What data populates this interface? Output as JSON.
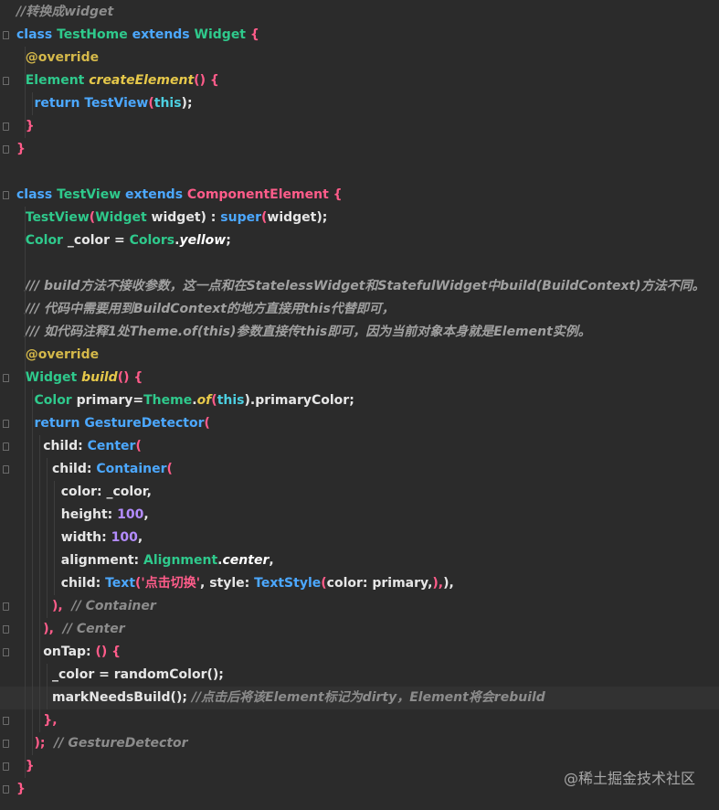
{
  "lines": [
    {
      "segments": [
        {
          "t": "//转换成widget",
          "c": "c-cmt"
        }
      ]
    },
    {
      "segments": [
        {
          "t": "class ",
          "c": "c-kw"
        },
        {
          "t": "TestHome ",
          "c": "c-type"
        },
        {
          "t": "extends ",
          "c": "c-kw"
        },
        {
          "t": "Widget ",
          "c": "c-type"
        },
        {
          "t": "{",
          "c": "c-pink"
        }
      ]
    },
    {
      "segments": [
        {
          "t": "  @override",
          "c": "c-anno"
        }
      ]
    },
    {
      "segments": [
        {
          "t": "  Element ",
          "c": "c-type"
        },
        {
          "t": "createElement",
          "c": "c-yellow"
        },
        {
          "t": "() {",
          "c": "c-pink"
        }
      ]
    },
    {
      "segments": [
        {
          "t": "    return ",
          "c": "c-kw"
        },
        {
          "t": "TestView",
          "c": "c-kw"
        },
        {
          "t": "(",
          "c": "c-pink"
        },
        {
          "t": "this",
          "c": "c-this"
        },
        {
          "t": ");",
          "c": "c-white"
        }
      ]
    },
    {
      "segments": [
        {
          "t": "  }",
          "c": "c-pink"
        }
      ]
    },
    {
      "segments": [
        {
          "t": "}",
          "c": "c-pink"
        }
      ]
    },
    {
      "segments": [
        {
          "t": "",
          "c": "c-white"
        }
      ]
    },
    {
      "segments": [
        {
          "t": "class ",
          "c": "c-kw"
        },
        {
          "t": "TestView ",
          "c": "c-type"
        },
        {
          "t": "extends ",
          "c": "c-kw"
        },
        {
          "t": "ComponentElement ",
          "c": "c-pink"
        },
        {
          "t": "{",
          "c": "c-pink"
        }
      ]
    },
    {
      "segments": [
        {
          "t": "  TestView",
          "c": "c-type"
        },
        {
          "t": "(",
          "c": "c-pink"
        },
        {
          "t": "Widget ",
          "c": "c-type"
        },
        {
          "t": "widget",
          "c": "c-white"
        },
        {
          "t": ") : ",
          "c": "c-white"
        },
        {
          "t": "super",
          "c": "c-kw"
        },
        {
          "t": "(",
          "c": "c-pink"
        },
        {
          "t": "widget",
          "c": "c-white"
        },
        {
          "t": ");",
          "c": "c-white"
        }
      ]
    },
    {
      "segments": [
        {
          "t": "  Color ",
          "c": "c-type"
        },
        {
          "t": "_color = ",
          "c": "c-white"
        },
        {
          "t": "Colors",
          "c": "c-type"
        },
        {
          "t": ".",
          "c": "c-white"
        },
        {
          "t": "yellow",
          "c": "c-italic"
        },
        {
          "t": ";",
          "c": "c-white"
        }
      ]
    },
    {
      "segments": [
        {
          "t": "",
          "c": "c-white"
        }
      ]
    },
    {
      "segments": [
        {
          "t": "  /// build方法不接收参数，这一点和在StatelessWidget和StatefulWidget中build(BuildContext)方法不同。",
          "c": "c-doc"
        }
      ]
    },
    {
      "segments": [
        {
          "t": "  /// 代码中需要用到BuildContext的地方直接用this代替即可，",
          "c": "c-doc"
        }
      ]
    },
    {
      "segments": [
        {
          "t": "  /// 如代码注释1处Theme.of(this)参数直接传this即可，因为当前对象本身就是Element实例。",
          "c": "c-doc"
        }
      ]
    },
    {
      "segments": [
        {
          "t": "  @override",
          "c": "c-anno"
        }
      ]
    },
    {
      "segments": [
        {
          "t": "  Widget ",
          "c": "c-type"
        },
        {
          "t": "build",
          "c": "c-yellow"
        },
        {
          "t": "() {",
          "c": "c-pink"
        }
      ]
    },
    {
      "segments": [
        {
          "t": "    Color ",
          "c": "c-type"
        },
        {
          "t": "primary=",
          "c": "c-white"
        },
        {
          "t": "Theme",
          "c": "c-type"
        },
        {
          "t": ".",
          "c": "c-white"
        },
        {
          "t": "of",
          "c": "c-yellow"
        },
        {
          "t": "(",
          "c": "c-pink"
        },
        {
          "t": "this",
          "c": "c-this"
        },
        {
          "t": ").primaryColor;",
          "c": "c-white"
        }
      ]
    },
    {
      "segments": [
        {
          "t": "    return ",
          "c": "c-kw"
        },
        {
          "t": "GestureDetector",
          "c": "c-kw"
        },
        {
          "t": "(",
          "c": "c-pink"
        }
      ]
    },
    {
      "segments": [
        {
          "t": "      child: ",
          "c": "c-white"
        },
        {
          "t": "Center",
          "c": "c-kw"
        },
        {
          "t": "(",
          "c": "c-pink"
        }
      ]
    },
    {
      "segments": [
        {
          "t": "        child: ",
          "c": "c-white"
        },
        {
          "t": "Container",
          "c": "c-kw"
        },
        {
          "t": "(",
          "c": "c-pink"
        }
      ]
    },
    {
      "segments": [
        {
          "t": "          color: _color,",
          "c": "c-white"
        }
      ]
    },
    {
      "segments": [
        {
          "t": "          height: ",
          "c": "c-white"
        },
        {
          "t": "100",
          "c": "c-num"
        },
        {
          "t": ",",
          "c": "c-white"
        }
      ]
    },
    {
      "segments": [
        {
          "t": "          width: ",
          "c": "c-white"
        },
        {
          "t": "100",
          "c": "c-num"
        },
        {
          "t": ",",
          "c": "c-white"
        }
      ]
    },
    {
      "segments": [
        {
          "t": "          alignment: ",
          "c": "c-white"
        },
        {
          "t": "Alignment",
          "c": "c-type"
        },
        {
          "t": ".",
          "c": "c-white"
        },
        {
          "t": "center",
          "c": "c-italic"
        },
        {
          "t": ",",
          "c": "c-white"
        }
      ]
    },
    {
      "segments": [
        {
          "t": "          child: ",
          "c": "c-white"
        },
        {
          "t": "Text",
          "c": "c-kw"
        },
        {
          "t": "('点击切换'",
          "c": "c-str"
        },
        {
          "t": ", style: ",
          "c": "c-white"
        },
        {
          "t": "TextStyle",
          "c": "c-kw"
        },
        {
          "t": "(",
          "c": "c-pink"
        },
        {
          "t": "color: primary,",
          "c": "c-white"
        },
        {
          "t": "),",
          "c": "c-pink"
        },
        {
          "t": "),",
          "c": "c-white"
        }
      ]
    },
    {
      "segments": [
        {
          "t": "        ),  ",
          "c": "c-pink"
        },
        {
          "t": "// Container",
          "c": "c-cmt"
        }
      ]
    },
    {
      "segments": [
        {
          "t": "      ),  ",
          "c": "c-pink"
        },
        {
          "t": "// Center",
          "c": "c-cmt"
        }
      ]
    },
    {
      "segments": [
        {
          "t": "      onTap: ",
          "c": "c-white"
        },
        {
          "t": "() {",
          "c": "c-pink"
        }
      ]
    },
    {
      "segments": [
        {
          "t": "        _color = randomColor();",
          "c": "c-white"
        }
      ]
    },
    {
      "segments": [
        {
          "t": "        markNeedsBuild(); ",
          "c": "c-white"
        },
        {
          "t": "//点击后将该Element标记为dirty，Element将会rebuild",
          "c": "c-cmt"
        }
      ]
    },
    {
      "segments": [
        {
          "t": "      },",
          "c": "c-pink"
        }
      ]
    },
    {
      "segments": [
        {
          "t": "    );  ",
          "c": "c-pink"
        },
        {
          "t": "// GestureDetector",
          "c": "c-cmt"
        }
      ]
    },
    {
      "segments": [
        {
          "t": "  }",
          "c": "c-pink"
        }
      ]
    },
    {
      "segments": [
        {
          "t": "}",
          "c": "c-pink"
        }
      ]
    }
  ],
  "highlighted_line": 30,
  "watermark": "@稀土掘金技术社区"
}
